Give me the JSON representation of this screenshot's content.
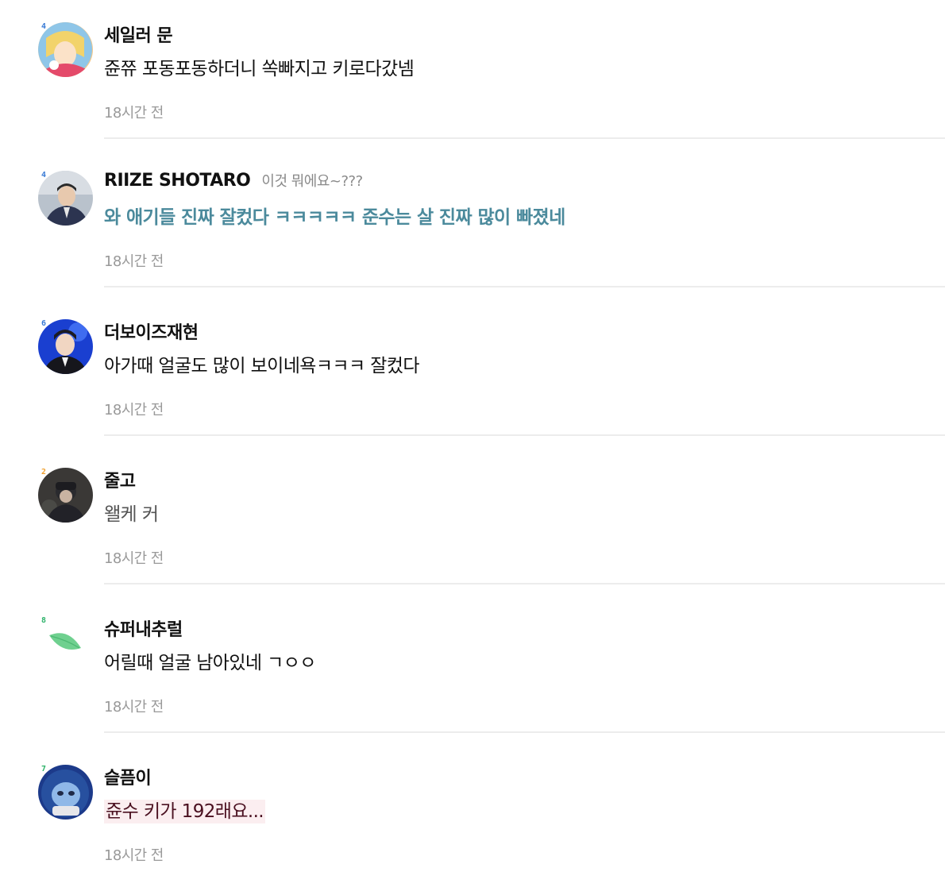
{
  "comments": [
    {
      "nick": "세일러 문",
      "title": "",
      "level": "4",
      "text": "쥰쮸 포동포동하더니 쏙빠지고 키로다갔넴",
      "time": "18시간 전"
    },
    {
      "nick": "RIIZE SHOTARO",
      "title": "이것 뭐에요~???",
      "level": "4",
      "text": "와 애기들 진짜 잘컸다 ㅋㅋㅋㅋㅋ 준수는 살 진짜 많이 빠졌네",
      "time": "18시간 전"
    },
    {
      "nick": "더보이즈재현",
      "title": "",
      "level": "6",
      "text": "아가때 얼굴도 많이 보이네욕ㅋㅋㅋ 잘컸다",
      "time": "18시간 전"
    },
    {
      "nick": "줄고",
      "title": "",
      "level": "2",
      "text": "왤케 커",
      "time": "18시간 전"
    },
    {
      "nick": "슈퍼내추럴",
      "title": "",
      "level": "8",
      "text": "어릴때 얼굴 남아있네 ㄱㅇㅇ",
      "time": "18시간 전"
    },
    {
      "nick": "슬픔이",
      "title": "",
      "level": "7",
      "text": "쥰수 키가 192래요...",
      "time": "18시간 전"
    }
  ],
  "colors": {
    "teal_text": "#4b8a9c",
    "level_blue": "#3a7bd5",
    "level_green": "#2fb36b",
    "level_orange": "#f0a030",
    "divider": "#ececec",
    "time": "#999999"
  },
  "icons": {
    "leaf_avatar": "leaf-icon"
  }
}
